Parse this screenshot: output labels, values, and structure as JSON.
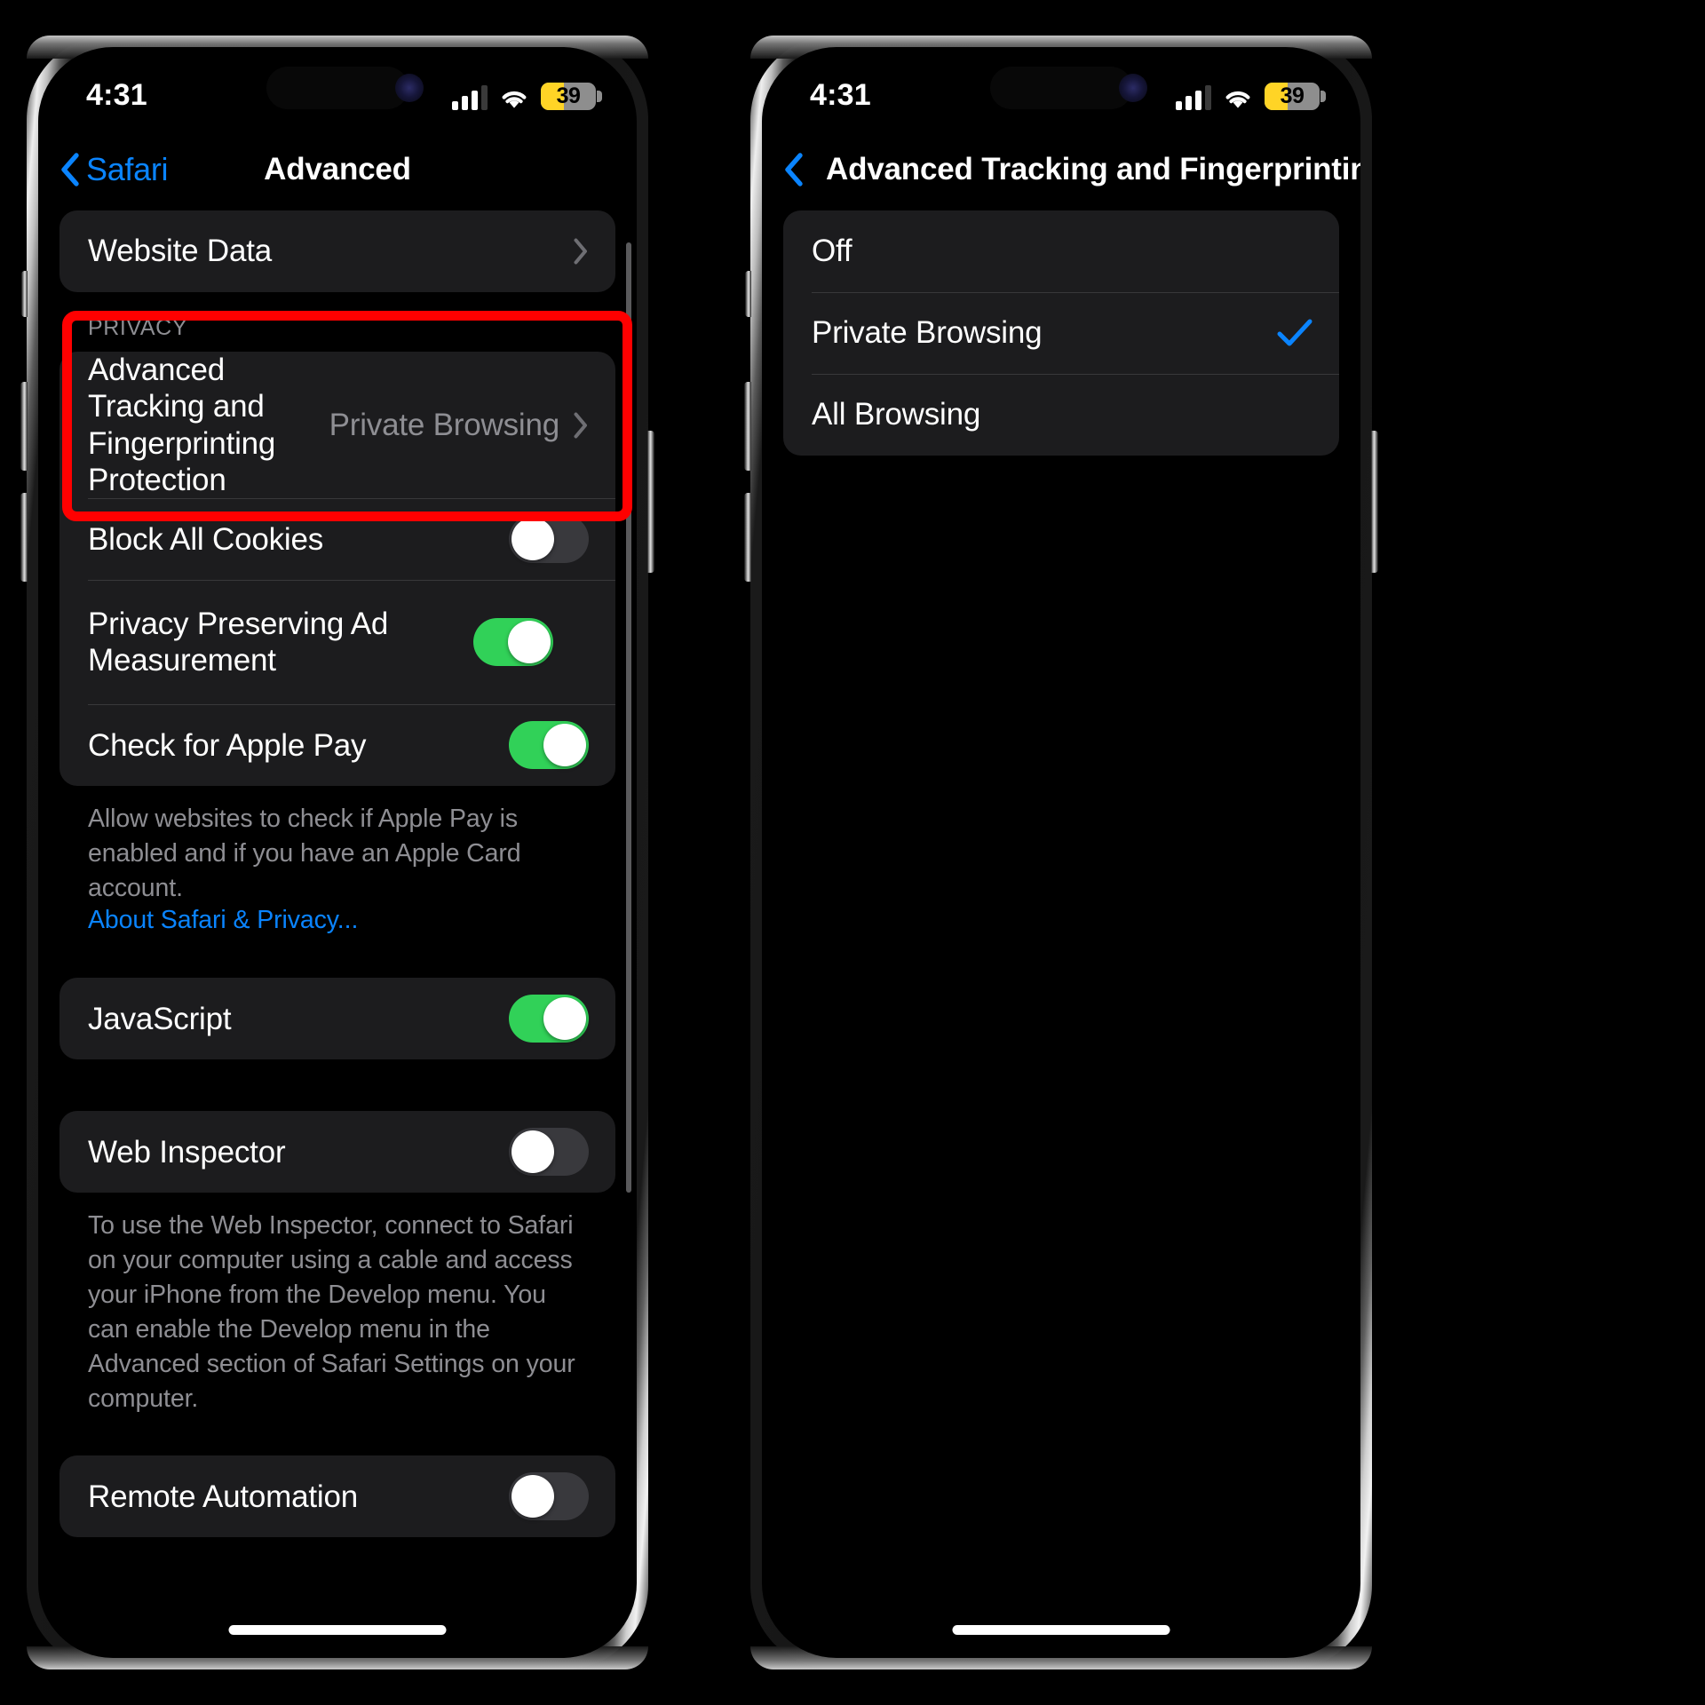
{
  "phones": [
    {
      "id": "safari-advanced",
      "status_bar": {
        "time": "4:31",
        "cellular_icon": "cellular-signal-icon",
        "wifi_icon": "wifi-icon",
        "battery_icon": "battery-icon",
        "battery_percent": "39",
        "battery_color": "#ffd426"
      },
      "nav": {
        "back_label": "Safari",
        "title": "Advanced"
      },
      "sections": [
        {
          "header": "",
          "rows": [
            {
              "label": "Website Data",
              "type": "disclosure",
              "value": ""
            }
          ],
          "footer": "",
          "footer_link": ""
        },
        {
          "header": "PRIVACY",
          "rows": [
            {
              "label": "Advanced Tracking and Fingerprinting Protection",
              "type": "disclosure",
              "value": "Private Browsing"
            },
            {
              "label": "Block All Cookies",
              "type": "toggle",
              "state": "off"
            },
            {
              "label": "Privacy Preserving Ad Measurement",
              "type": "toggle",
              "state": "on"
            },
            {
              "label": "Check for Apple Pay",
              "type": "toggle",
              "state": "on"
            }
          ],
          "footer": "Allow websites to check if Apple Pay is enabled and if you have an Apple Card account.",
          "footer_link": "About Safari & Privacy..."
        },
        {
          "header": "",
          "rows": [
            {
              "label": "JavaScript",
              "type": "toggle",
              "state": "on"
            }
          ],
          "footer": "",
          "footer_link": ""
        },
        {
          "header": "",
          "rows": [
            {
              "label": "Web Inspector",
              "type": "toggle",
              "state": "off"
            }
          ],
          "footer": "To use the Web Inspector, connect to Safari on your computer using a cable and access your iPhone from the Develop menu. You can enable the Develop menu in the Advanced section of Safari Settings on your computer.",
          "footer_link": ""
        },
        {
          "header": "",
          "rows": [
            {
              "label": "Remote Automation",
              "type": "toggle",
              "state": "off"
            }
          ],
          "footer": "",
          "footer_link": ""
        }
      ],
      "annotation": {
        "type": "highlight-rectangle",
        "color": "#ff0000",
        "targets": "PRIVACY header and Advanced Tracking and Fingerprinting Protection row"
      }
    },
    {
      "id": "atfp-options",
      "status_bar": {
        "time": "4:31",
        "cellular_icon": "cellular-signal-icon",
        "wifi_icon": "wifi-icon",
        "battery_icon": "battery-icon",
        "battery_percent": "39",
        "battery_color": "#ffd426"
      },
      "nav": {
        "back_label": "",
        "title": "Advanced Tracking and Fingerprinting..."
      },
      "options": [
        {
          "label": "Off",
          "selected": false
        },
        {
          "label": "Private Browsing",
          "selected": true
        },
        {
          "label": "All Browsing",
          "selected": false
        }
      ]
    }
  ],
  "colors": {
    "accent_blue": "#0a84ff",
    "toggle_on_green": "#31d158",
    "toggle_off_gray": "#39393d",
    "group_bg": "#1c1c1e",
    "secondary_text": "#8e8e93",
    "highlight_red": "#ff0000",
    "battery_yellow": "#ffd426"
  }
}
